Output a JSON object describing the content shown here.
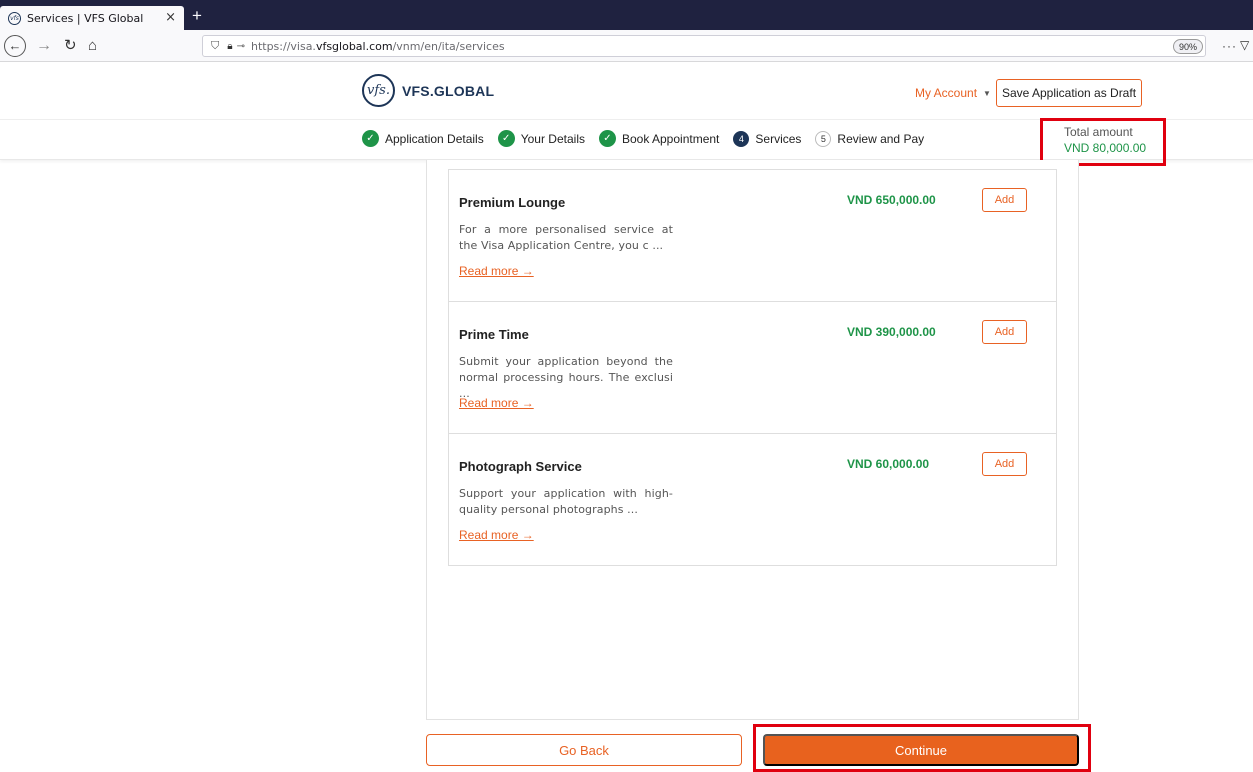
{
  "browser": {
    "tab_title": "Services | VFS Global",
    "tab_close": "×",
    "new_tab": "+",
    "url_prefix": "https://visa.",
    "url_domain": "vfsglobal.com",
    "url_path": "/vnm/en/ita/services",
    "zoom": "90%",
    "menu": "···"
  },
  "header": {
    "logo_text": "vfs.",
    "brand": "VFS.GLOBAL",
    "my_account": "My Account",
    "save_draft": "Save Application as Draft"
  },
  "steps": [
    {
      "label": "Application Details",
      "state": "done"
    },
    {
      "label": "Your Details",
      "state": "done"
    },
    {
      "label": "Book Appointment",
      "state": "done"
    },
    {
      "label": "Services",
      "number": "4",
      "state": "current"
    },
    {
      "label": "Review and Pay",
      "number": "5",
      "state": "pending"
    }
  ],
  "total": {
    "label": "Total amount",
    "amount": "VND 80,000.00"
  },
  "services": [
    {
      "title": "Premium Lounge",
      "description": "For a more personalised service at the Visa Application Centre, you c ...",
      "read_more": "Read more →",
      "price": "VND 650,000.00",
      "add_label": "Add"
    },
    {
      "title": "Prime Time",
      "description": "Submit your application beyond the normal processing hours. The exclusi ...",
      "read_more": "Read more →",
      "price": "VND 390,000.00",
      "add_label": "Add"
    },
    {
      "title": "Photograph Service",
      "description": "Support your application with high-quality personal photographs ...",
      "read_more": "Read more →",
      "price": "VND 60,000.00",
      "add_label": "Add"
    }
  ],
  "actions": {
    "go_back": "Go Back",
    "continue": "Continue"
  },
  "colors": {
    "accent": "#e86224",
    "success": "#1e9448",
    "brand": "#1d3557",
    "highlight": "#e0000f"
  }
}
